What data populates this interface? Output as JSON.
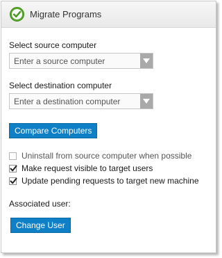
{
  "header": {
    "title": "Migrate Programs",
    "icon": "checkmark-circle-icon"
  },
  "source": {
    "label": "Select source computer",
    "placeholder": "Enter a source computer",
    "value": ""
  },
  "destination": {
    "label": "Select destination computer",
    "placeholder": "Enter a destination computer",
    "value": ""
  },
  "compare_button": "Compare Computers",
  "options": [
    {
      "label": "Uninstall from source computer when possible",
      "checked": false
    },
    {
      "label": "Make request visible to target users",
      "checked": true
    },
    {
      "label": "Update pending requests to target new machine",
      "checked": true
    }
  ],
  "associated_user_label": "Associated user:",
  "change_user_button": "Change User",
  "colors": {
    "button_blue": "#0f7fc6",
    "header_icon_green": "#5aa82b",
    "dropdown_arrow_bg": "#a9a9a9"
  }
}
